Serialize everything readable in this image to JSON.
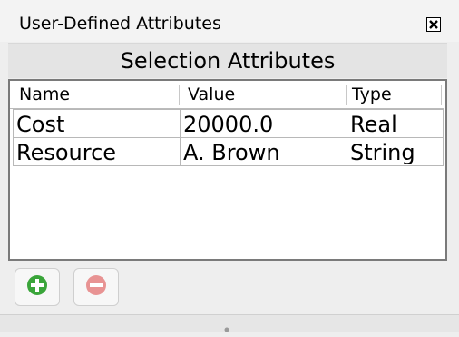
{
  "window": {
    "title": "User-Defined Attributes",
    "close_icon": "close-icon"
  },
  "section": {
    "title": "Selection Attributes"
  },
  "table": {
    "columns": [
      "Name",
      "Value",
      "Type"
    ],
    "rows": [
      {
        "name": "Cost",
        "value": "20000.0",
        "type": "Real"
      },
      {
        "name": "Resource",
        "value": "A. Brown",
        "type": "String"
      }
    ]
  },
  "toolbar": {
    "add_icon": "plus-circle-icon",
    "remove_icon": "minus-circle-icon",
    "colors": {
      "add": "#3aa53a",
      "remove": "#e89393"
    }
  }
}
